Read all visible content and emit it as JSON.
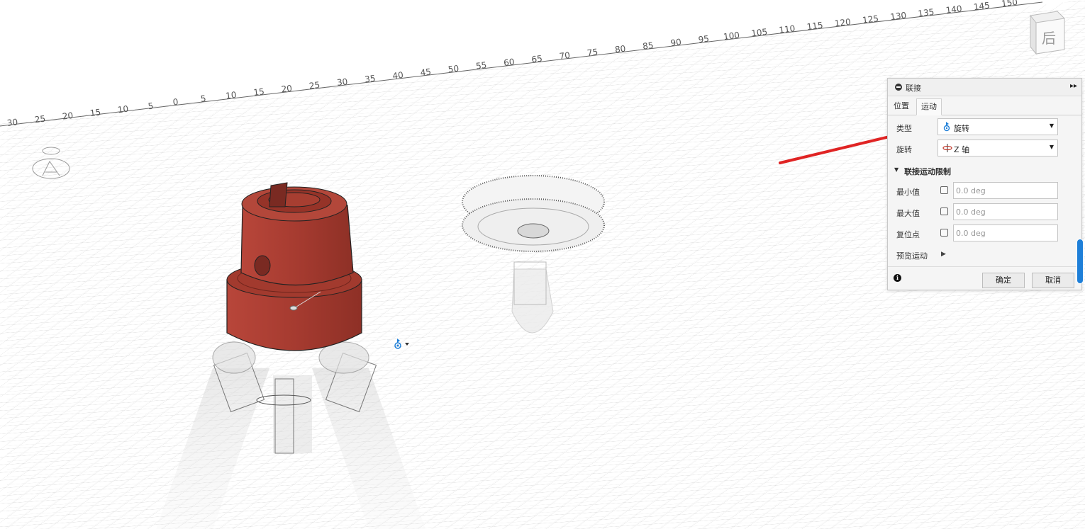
{
  "ruler": {
    "left_labels": [
      "30",
      "25",
      "20",
      "15",
      "10",
      "5"
    ],
    "right_labels": [
      "0",
      "5",
      "10",
      "15",
      "20",
      "25",
      "30",
      "35",
      "40",
      "45",
      "50",
      "55",
      "60",
      "65",
      "70",
      "75",
      "80",
      "85",
      "90",
      "95",
      "100",
      "105",
      "110",
      "115",
      "120",
      "125",
      "130",
      "135",
      "140",
      "145",
      "150"
    ]
  },
  "view_cube": {
    "face_label": "后"
  },
  "joint_panel": {
    "title": "联接",
    "tabs": [
      "位置",
      "运动"
    ],
    "active_tab": "运动",
    "type_label": "类型",
    "type_value": "旋转",
    "rotation_label": "旋转",
    "rotation_value": "Z 轴",
    "limits_section": "联接运动限制",
    "min_label": "最小值",
    "max_label": "最大值",
    "rest_label": "复位点",
    "min_value": "0.0 deg",
    "max_value": "0.0 deg",
    "rest_value": "0.0 deg",
    "preview_label": "预览运动",
    "ok_button": "确定",
    "cancel_button": "取消"
  },
  "icons": {
    "collapse": "minus-circle-icon",
    "expand": "double-chevron-right-icon",
    "joint_type": "revolute-joint-icon",
    "axis": "rotate-axis-icon",
    "info": "info-icon",
    "play": "play-icon",
    "dropdown": "caret-down-icon"
  },
  "colors": {
    "part_red": "#a33a2e",
    "annotation_arrow": "#e02424",
    "accent_blue": "#1e7fd8",
    "grid": "#d6d6d6"
  }
}
